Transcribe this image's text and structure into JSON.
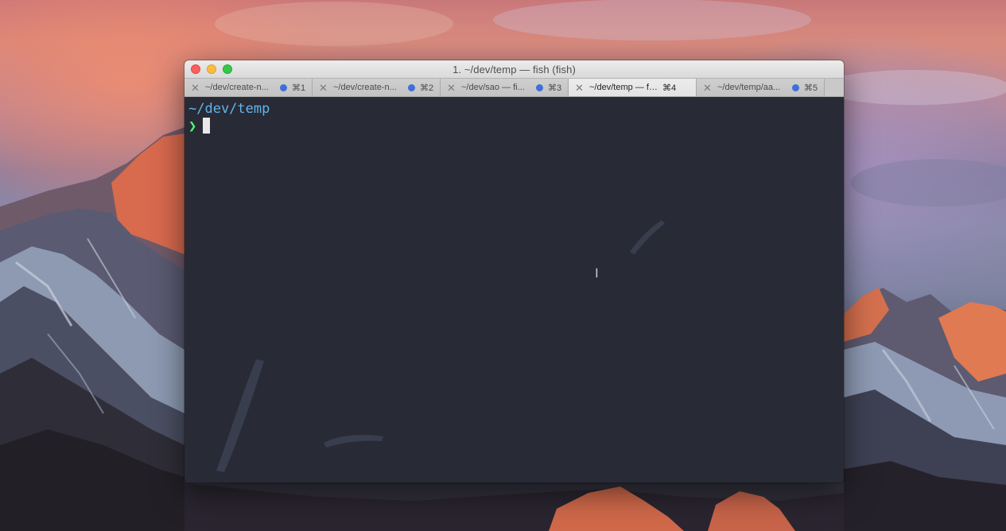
{
  "window": {
    "title": "1. ~/dev/temp — fish (fish)",
    "traffic_lights": [
      "close",
      "minimize",
      "zoom"
    ]
  },
  "tabs": [
    {
      "label": "~/dev/create-n...",
      "shortcut": "⌘1",
      "close_icon": "✕",
      "active": false
    },
    {
      "label": "~/dev/create-n...",
      "shortcut": "⌘2",
      "close_icon": "✕",
      "active": false
    },
    {
      "label": "~/dev/sao — fi...",
      "shortcut": "⌘3",
      "close_icon": "✕",
      "active": false
    },
    {
      "label": "~/dev/temp — fis...",
      "shortcut": "⌘4",
      "close_icon": "✕",
      "active": true
    },
    {
      "label": "~/dev/temp/aa...",
      "shortcut": "⌘5",
      "close_icon": "✕",
      "active": false
    }
  ],
  "terminal": {
    "cwd": "~/dev/temp",
    "prompt_symbol": "❯",
    "input": ""
  },
  "pointer": {
    "icon": "ibeam-cursor-icon",
    "glyph": "I"
  },
  "colors": {
    "terminal_bg": "#282a36",
    "cwd_text": "#62b5e8",
    "prompt": "#50fa7b",
    "tab_activity_dot": "#3f6fd8"
  }
}
